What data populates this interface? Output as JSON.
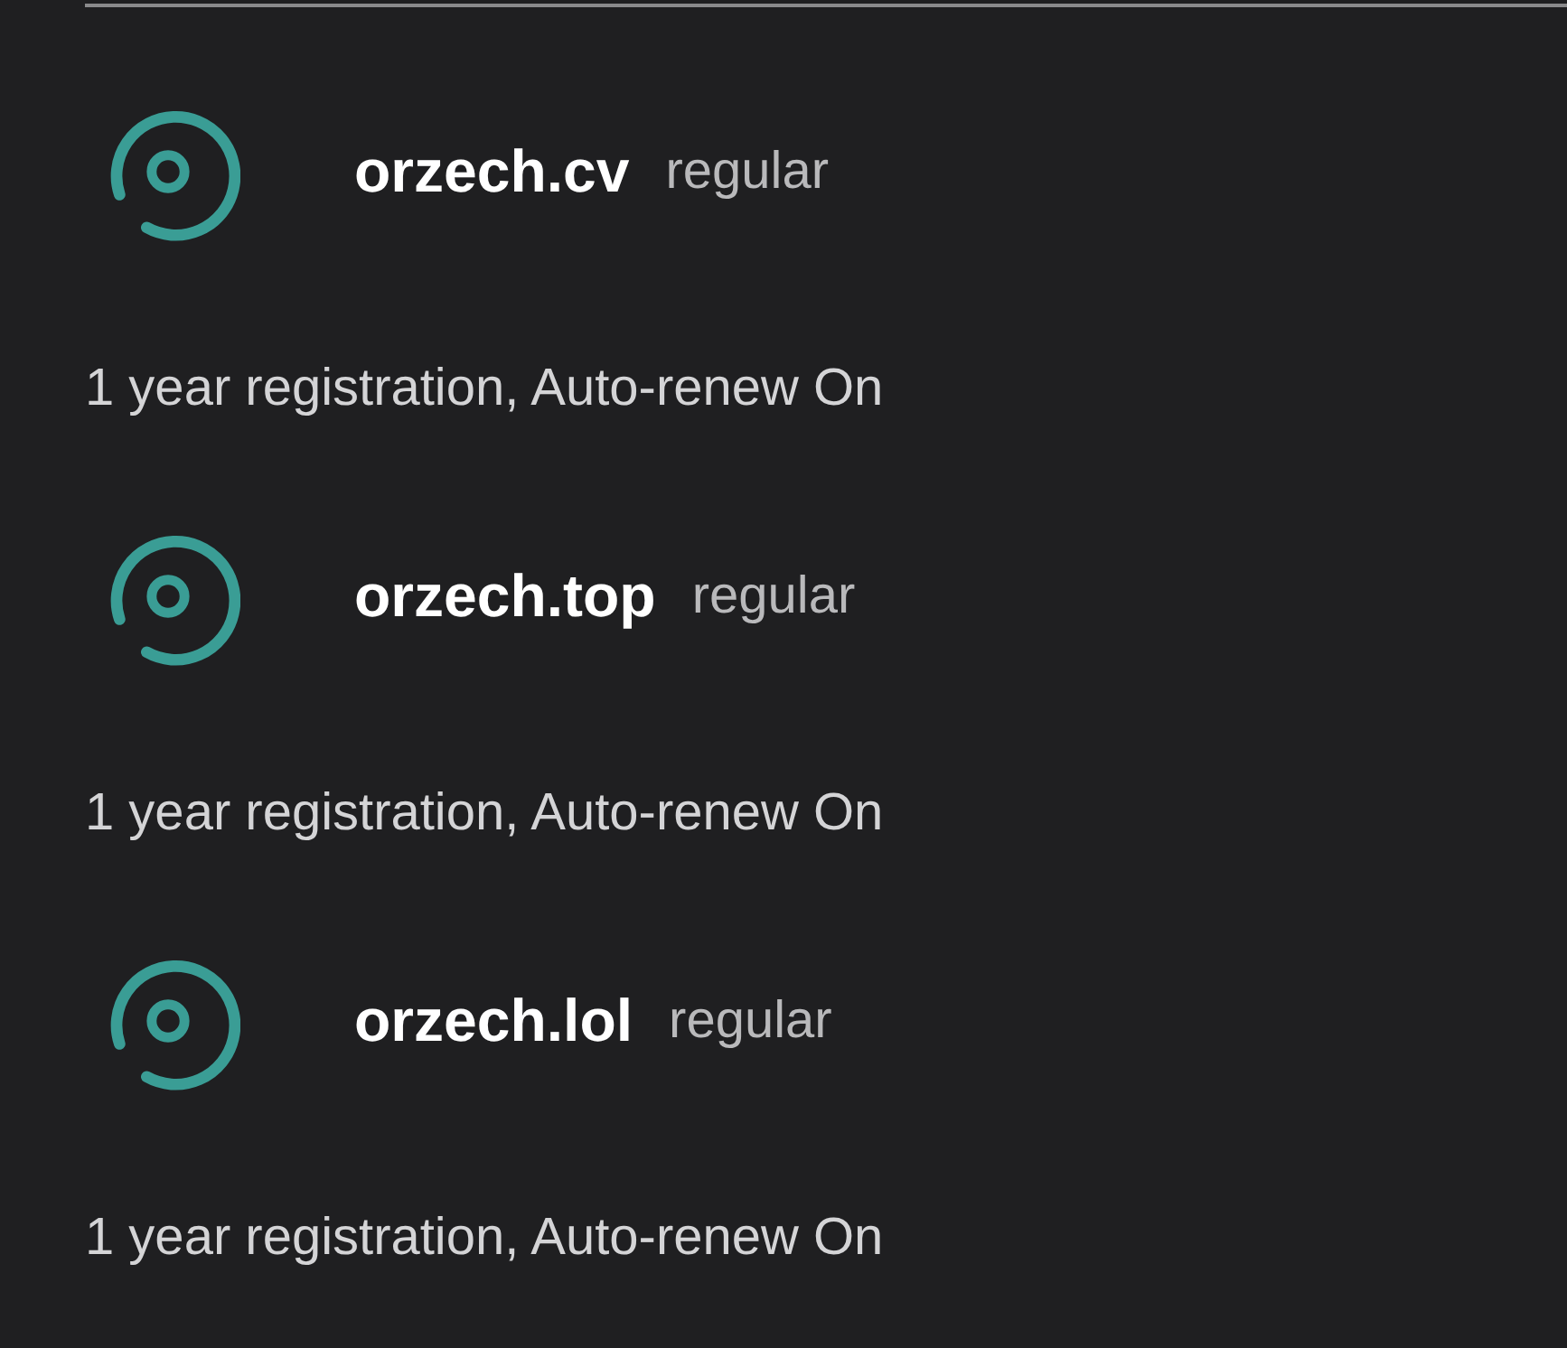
{
  "domains": [
    {
      "name": "orzech.cv",
      "tier": "regular",
      "description": "1 year registration, Auto-renew On"
    },
    {
      "name": "orzech.top",
      "tier": "regular",
      "description": "1 year registration, Auto-renew On"
    },
    {
      "name": "orzech.lol",
      "tier": "regular",
      "description": "1 year registration, Auto-renew On"
    }
  ]
}
